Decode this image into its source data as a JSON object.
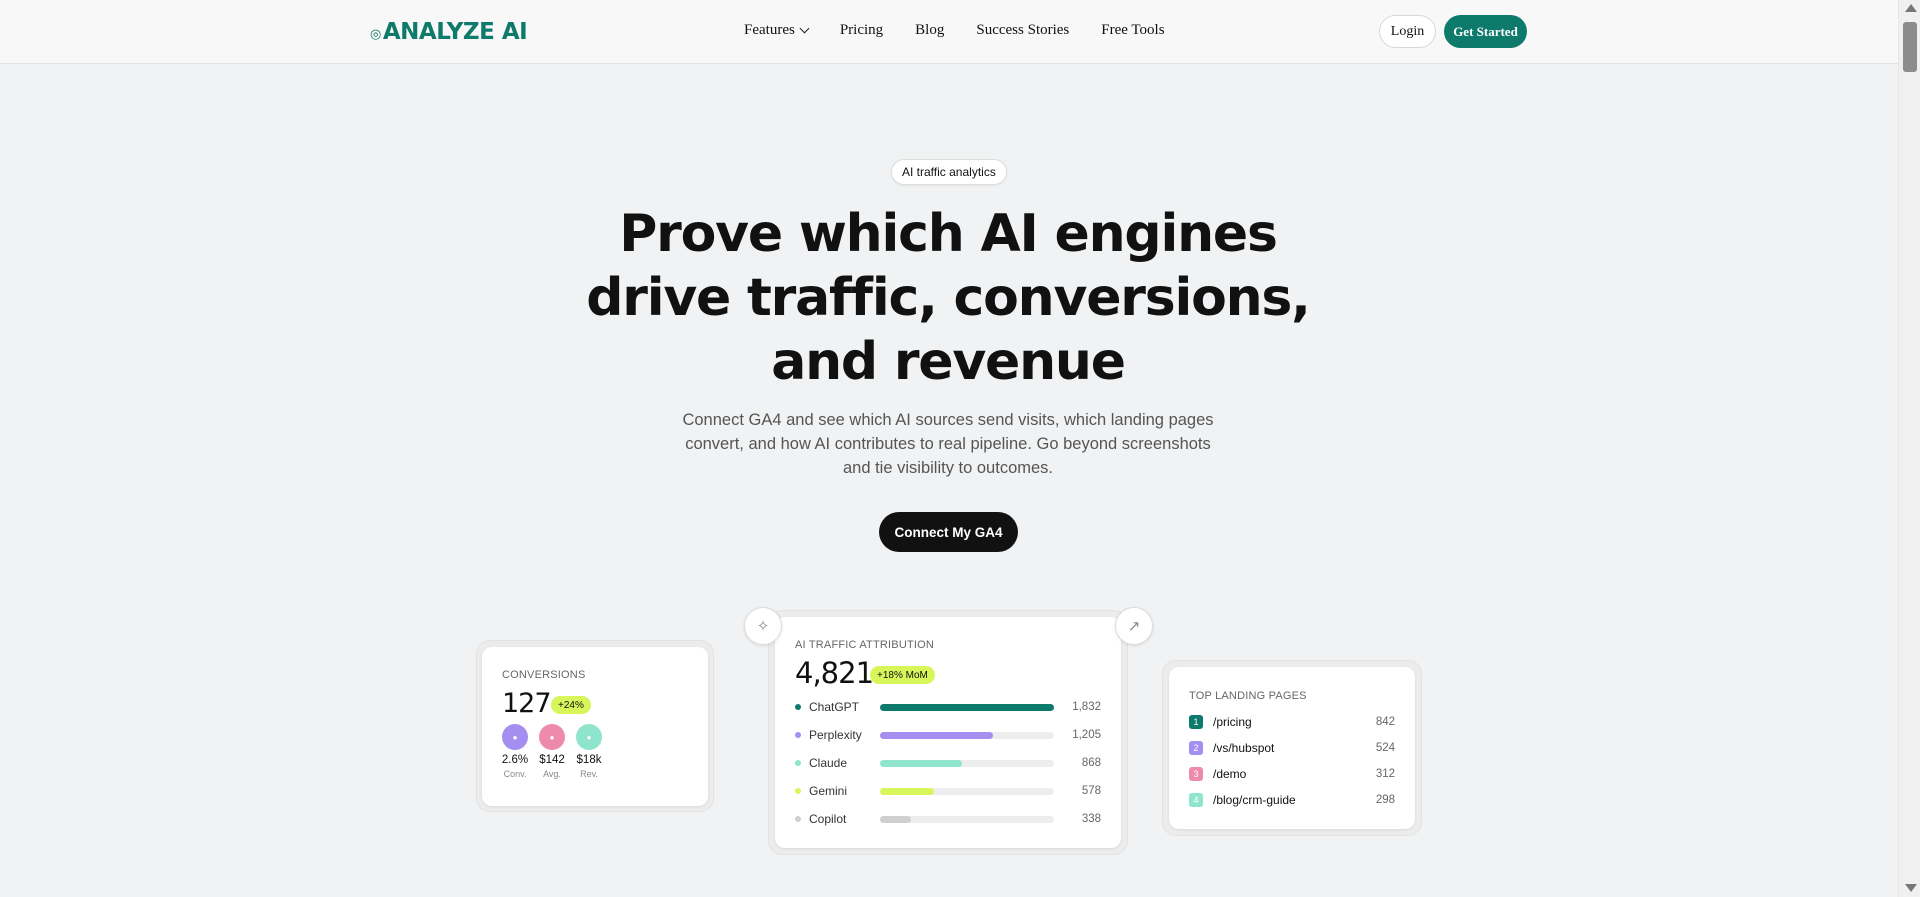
{
  "header": {
    "logo_text": "ANALYZE AI",
    "nav": [
      {
        "label": "Features"
      },
      {
        "label": "Pricing"
      },
      {
        "label": "Blog"
      },
      {
        "label": "Success Stories"
      },
      {
        "label": "Free Tools"
      }
    ],
    "login_label": "Login",
    "get_started_label": "Get Started"
  },
  "hero": {
    "pill": "AI traffic analytics",
    "headline": "Prove which AI engines drive traffic, conversions, and revenue",
    "subheadline": "Connect GA4 and see which AI sources send visits, which landing pages convert, and how AI contributes to real pipeline. Go beyond screenshots and tie visibility to outcomes.",
    "cta": "Connect My GA4"
  },
  "conversions_card": {
    "label": "CONVERSIONS",
    "value": "127",
    "badge": "+24%",
    "metrics": [
      {
        "value": "2.6%",
        "label": "Conv.",
        "color": "#a48ff0"
      },
      {
        "value": "$142",
        "label": "Avg.",
        "color": "#ee8aab"
      },
      {
        "value": "$18k",
        "label": "Rev.",
        "color": "#8fe5cc"
      }
    ]
  },
  "attribution_card": {
    "label": "AI TRAFFIC ATTRIBUTION",
    "value": "4,821",
    "badge": "+18% MoM",
    "rows": [
      {
        "name": "ChatGPT",
        "value": "1,832",
        "fraction": 1.0,
        "color": "#0e7a6b"
      },
      {
        "name": "Perplexity",
        "value": "1,205",
        "fraction": 0.65,
        "color": "#a48ff0"
      },
      {
        "name": "Claude",
        "value": "868",
        "fraction": 0.47,
        "color": "#8fe5cc"
      },
      {
        "name": "Gemini",
        "value": "578",
        "fraction": 0.31,
        "color": "#d8f55a"
      },
      {
        "name": "Copilot",
        "value": "338",
        "fraction": 0.18,
        "color": "#cfcfcf"
      }
    ]
  },
  "landing_card": {
    "label": "TOP LANDING PAGES",
    "rows": [
      {
        "rank": "1",
        "path": "/pricing",
        "value": "842",
        "color": "#0e7a6b"
      },
      {
        "rank": "2",
        "path": "/vs/hubspot",
        "value": "524",
        "color": "#a48ff0"
      },
      {
        "rank": "3",
        "path": "/demo",
        "value": "312",
        "color": "#ee8aab"
      },
      {
        "rank": "4",
        "path": "/blog/crm-guide",
        "value": "298",
        "color": "#8fe5cc"
      }
    ]
  },
  "icons": {
    "sparkle": "sparkle-icon",
    "arrow": "arrow-up-right-icon"
  }
}
